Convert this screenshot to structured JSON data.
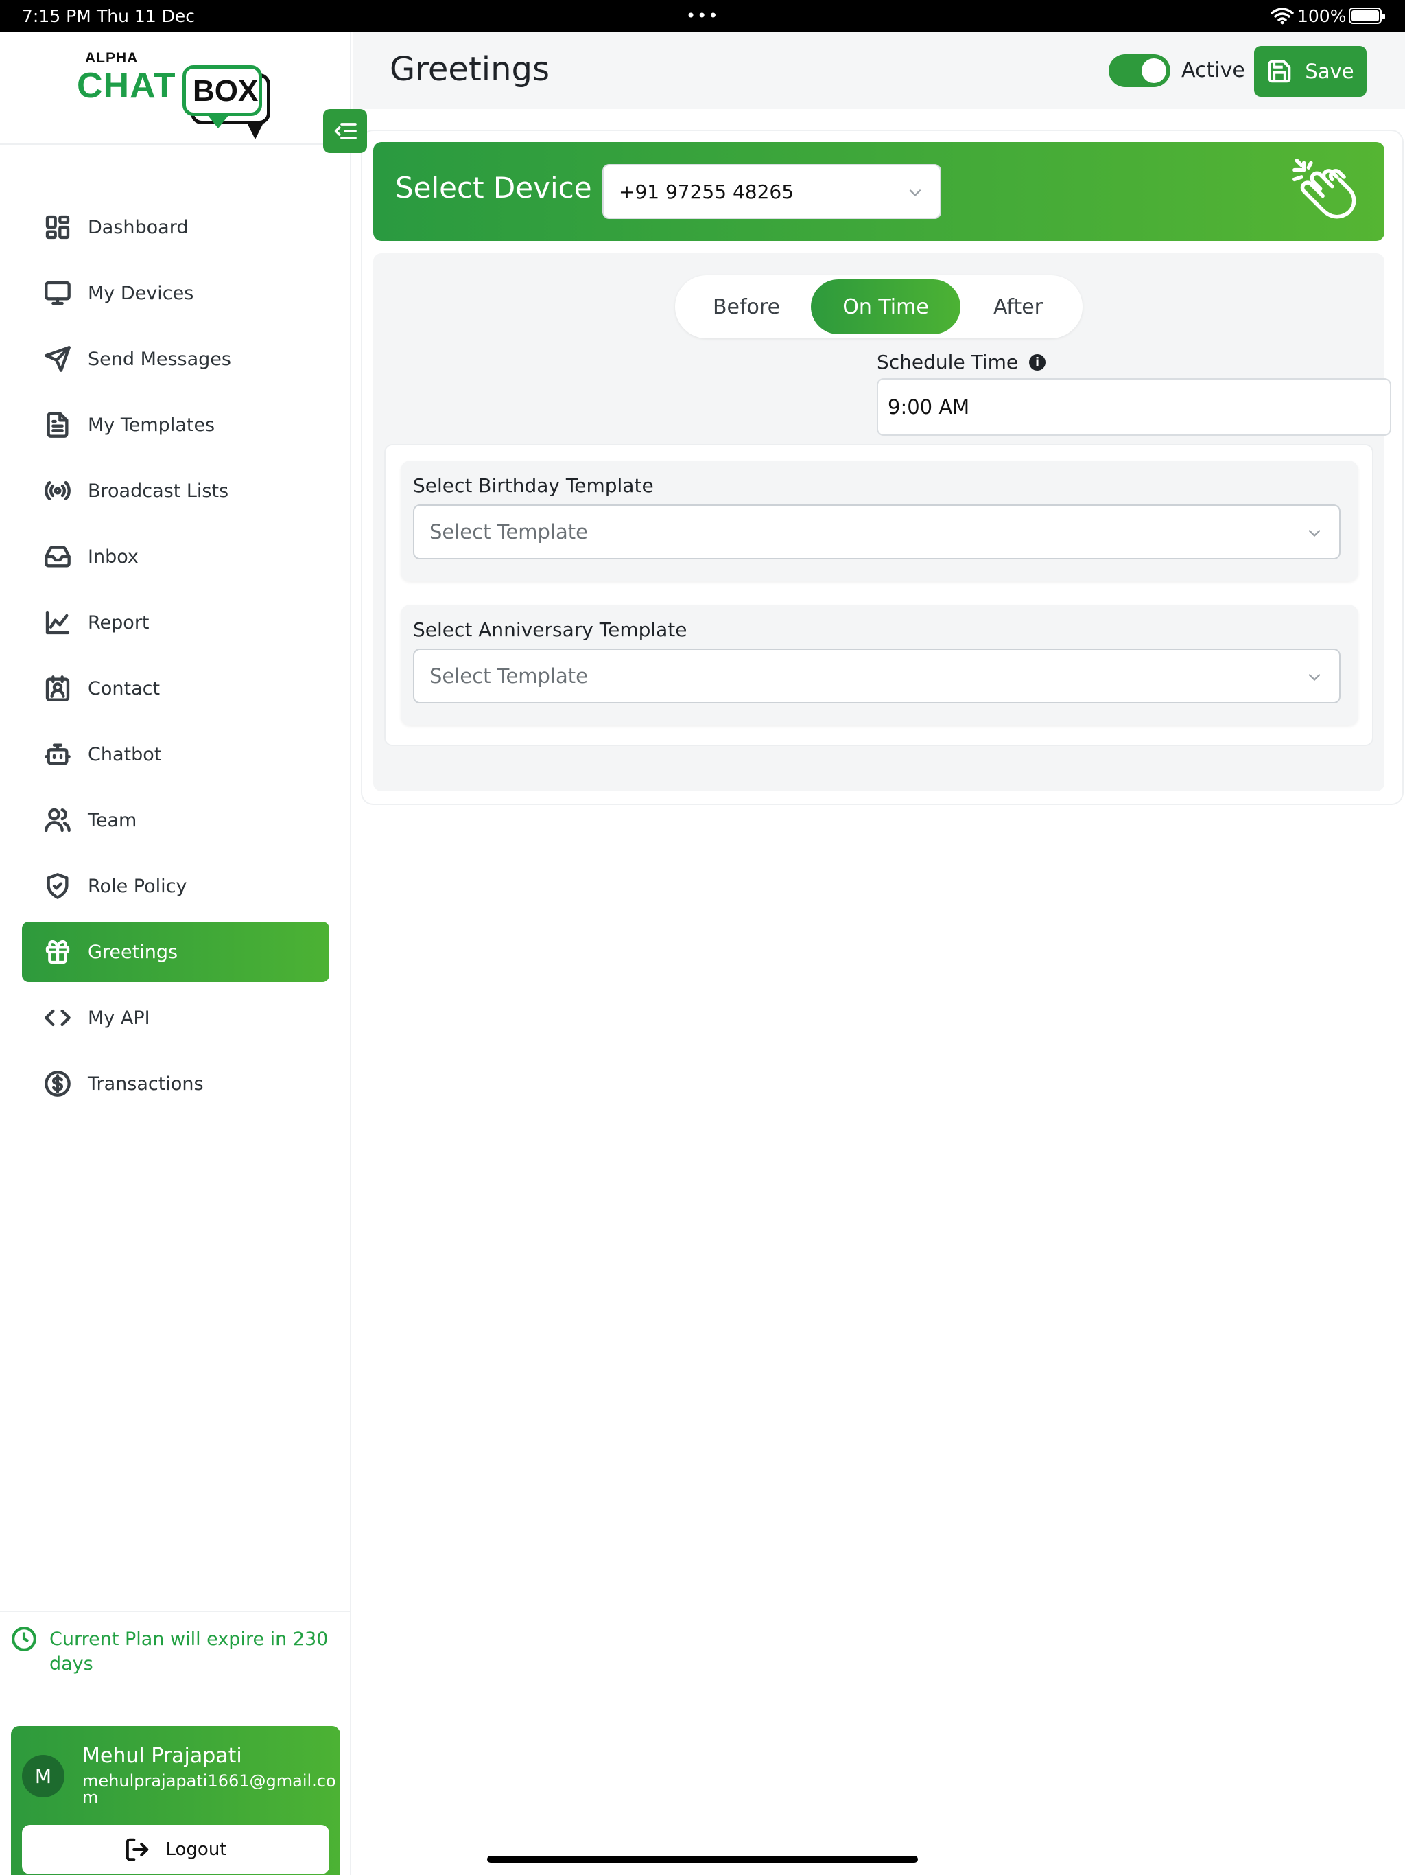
{
  "status_bar": {
    "time": "7:15 PM",
    "date": "Thu 11 Dec",
    "dots": "•••",
    "battery": "100%"
  },
  "logo": {
    "alpha": "ALPHA",
    "chat": "CHAT",
    "box": "BOX"
  },
  "sidebar": {
    "items": [
      {
        "label": "Dashboard",
        "icon": "grid-icon"
      },
      {
        "label": "My Devices",
        "icon": "monitor-icon"
      },
      {
        "label": "Send Messages",
        "icon": "send-icon"
      },
      {
        "label": "My Templates",
        "icon": "document-icon"
      },
      {
        "label": "Broadcast Lists",
        "icon": "broadcast-icon"
      },
      {
        "label": "Inbox",
        "icon": "inbox-icon"
      },
      {
        "label": "Report",
        "icon": "chart-icon"
      },
      {
        "label": "Contact",
        "icon": "contact-icon"
      },
      {
        "label": "Chatbot",
        "icon": "robot-icon"
      },
      {
        "label": "Team",
        "icon": "users-icon"
      },
      {
        "label": "Role Policy",
        "icon": "shield-icon"
      },
      {
        "label": "Greetings",
        "icon": "gift-icon",
        "active": true
      },
      {
        "label": "My API",
        "icon": "code-icon"
      },
      {
        "label": "Transactions",
        "icon": "dollar-icon"
      }
    ],
    "plan_text": "Current Plan will expire in 230 days",
    "user": {
      "initial": "M",
      "name": "Mehul Prajapati",
      "email": "mehulprajapati1661@gmail.com",
      "logout_label": "Logout"
    }
  },
  "header": {
    "title": "Greetings",
    "active_label": "Active",
    "active_on": true,
    "save_label": "Save"
  },
  "device": {
    "label": "Select Device",
    "selected": "+91 97255 48265"
  },
  "timing": {
    "options": [
      "Before",
      "On Time",
      "After"
    ],
    "selected": "On Time",
    "schedule_label": "Schedule Time",
    "schedule_value": "9:00 AM"
  },
  "templates": {
    "birthday_label": "Select Birthday Template",
    "birthday_placeholder": "Select Template",
    "anniversary_label": "Select Anniversary Template",
    "anniversary_placeholder": "Select Template"
  },
  "colors": {
    "accent": "#2e9a3c",
    "accent_light": "#4cb234",
    "plan_text": "#22a042"
  }
}
